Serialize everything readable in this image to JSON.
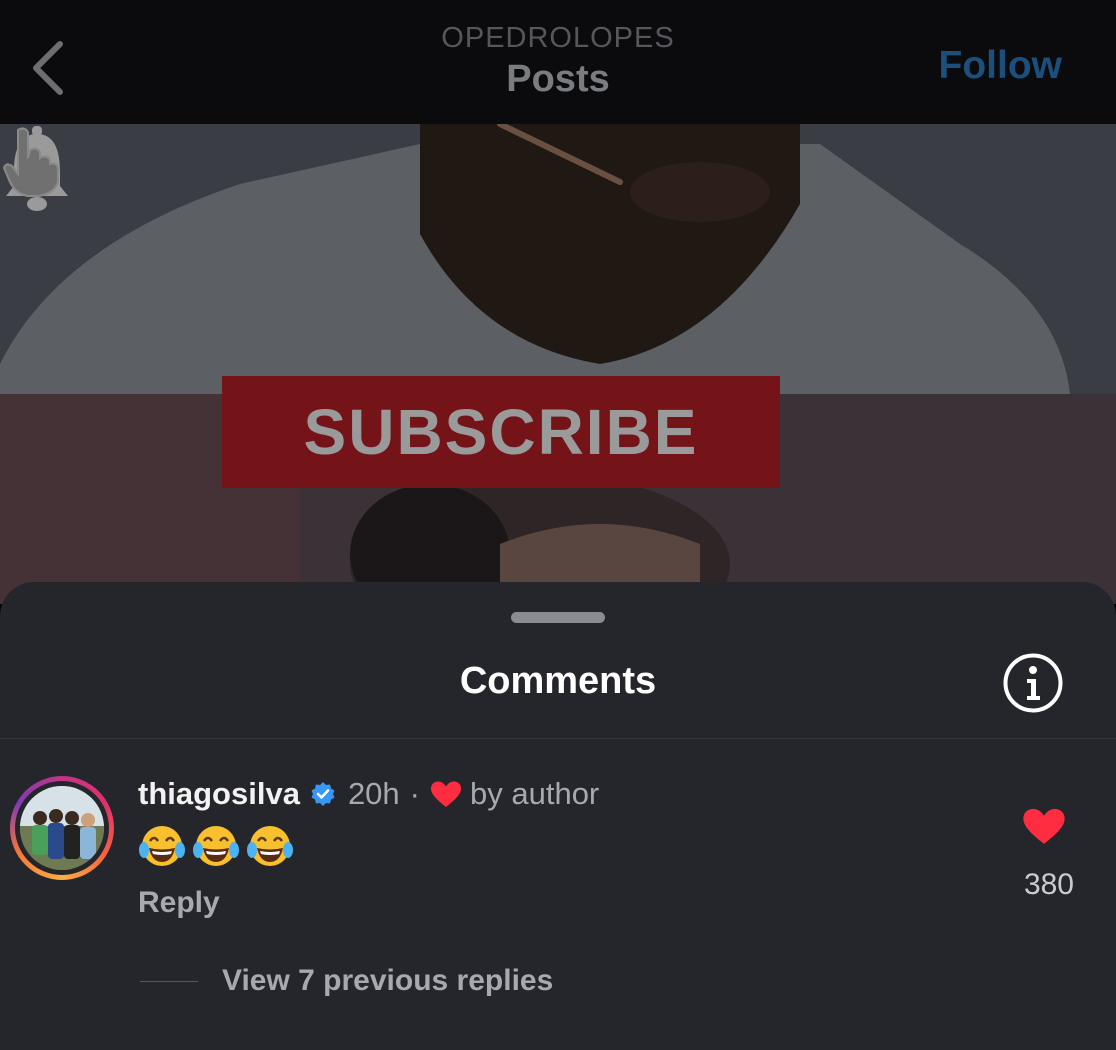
{
  "header": {
    "account": "OPEDROLOPES",
    "title": "Posts",
    "follow_label": "Follow"
  },
  "post": {
    "subscribe_text": "SUBSCRIBE"
  },
  "comments_sheet": {
    "title": "Comments",
    "comment": {
      "username": "thiagosilva",
      "verified": true,
      "time": "20h",
      "separator": "·",
      "liked_by_author_label": "by author",
      "emojis": [
        "😂",
        "😂",
        "😂"
      ],
      "reply_label": "Reply",
      "like_count": "380"
    },
    "view_replies_label": "View 7 previous replies"
  },
  "colors": {
    "follow": "#1d4f7c",
    "heart": "#ff2d3f",
    "verified": "#3897f0",
    "sheet_bg": "#25262b"
  }
}
